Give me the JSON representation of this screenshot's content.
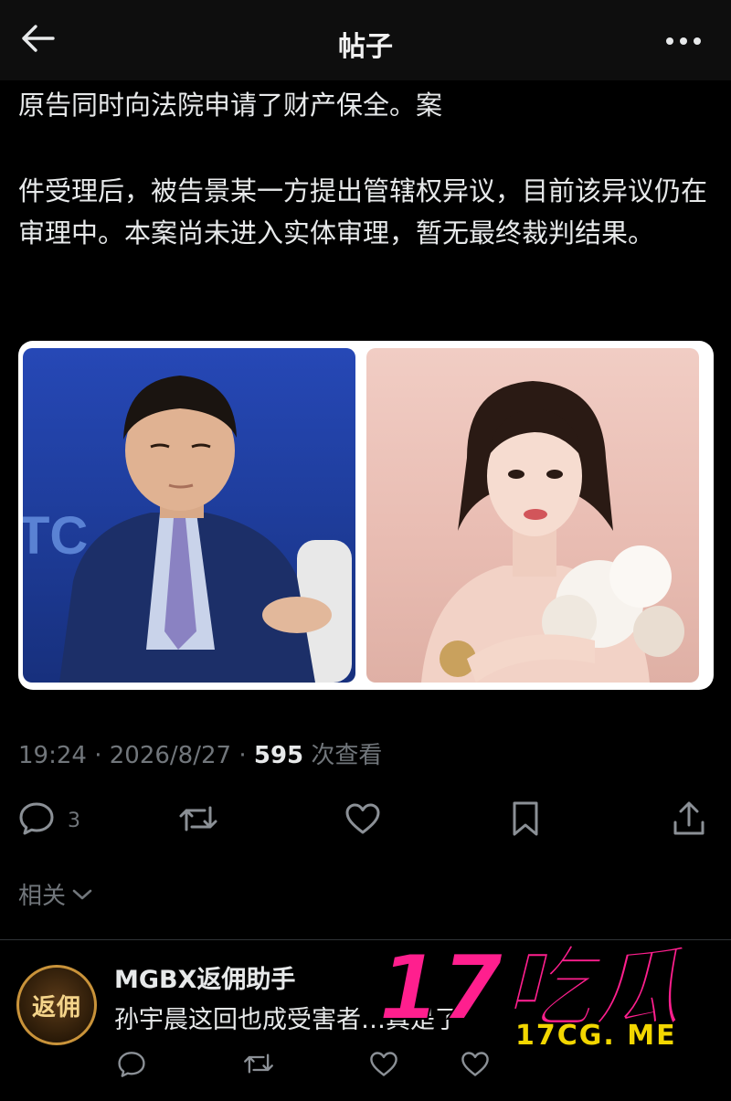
{
  "topbar": {
    "title": "帖子",
    "back_icon": "arrow-left-icon",
    "more_icon": "more-horizontal-icon"
  },
  "post": {
    "paragraphs": [
      "原告同时向法院申请了财产保全。案",
      "件受理后，被告景某一方提出管辖权异议，目前该异议仍在审理中。本案尚未进入实体审理，暂无最终裁判结果。"
    ],
    "images": [
      {
        "label": "photo-man-in-suit",
        "bg": "#1f3e9e"
      },
      {
        "label": "photo-woman-with-flowers",
        "bg": "#e9bdb3"
      }
    ],
    "time": "19:24",
    "date": "2026/8/27",
    "views": "595",
    "views_label": "次查看",
    "separator": "·"
  },
  "actions": {
    "reply_count": "3",
    "icons": [
      "reply-icon",
      "repost-icon",
      "like-icon",
      "bookmark-icon",
      "share-icon"
    ]
  },
  "related": {
    "label": "相关"
  },
  "reply": {
    "avatar_text": "返佣",
    "name": "MGBX返佣助手",
    "text": "孙宇晨这回也成受害者…真是了"
  },
  "watermark": {
    "big": "17吃瓜",
    "site": "17CG. ME"
  },
  "colors": {
    "background": "#000000",
    "text": "#e7e9ea",
    "muted": "#71767b",
    "watermark": "#ff1f8e"
  }
}
